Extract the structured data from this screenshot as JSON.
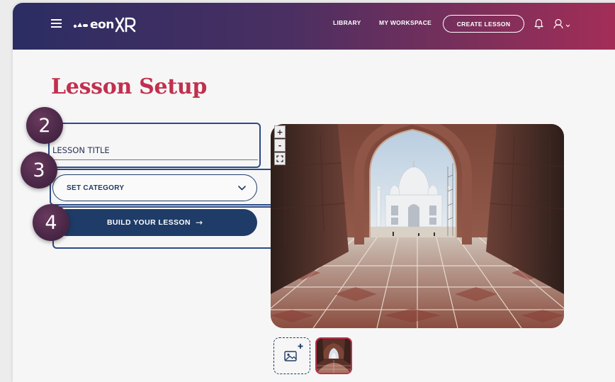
{
  "header": {
    "logo_text": "eon",
    "logo_suffix": "XR",
    "nav": {
      "library": "LIBRARY",
      "workspace": "MY WORKSPACE",
      "create_lesson": "CREATE LESSON"
    },
    "icons": [
      "hamburger-icon",
      "bell-icon",
      "user-icon",
      "chevron-down-icon"
    ]
  },
  "main": {
    "title": "Lesson Setup",
    "lesson_title_placeholder": "LESSON TITLE",
    "category_label": "SET CATEGORY",
    "build_button": "BUILD YOUR LESSON",
    "build_arrow": "→"
  },
  "tutorial": {
    "markers": [
      "2",
      "3",
      "4"
    ]
  },
  "viewer": {
    "zoom_in": "+",
    "zoom_out": "-"
  },
  "colors": {
    "accent": "#c1304e",
    "primary": "#1f3b67",
    "header_start": "#2b2d63",
    "header_end": "#a32e57"
  }
}
